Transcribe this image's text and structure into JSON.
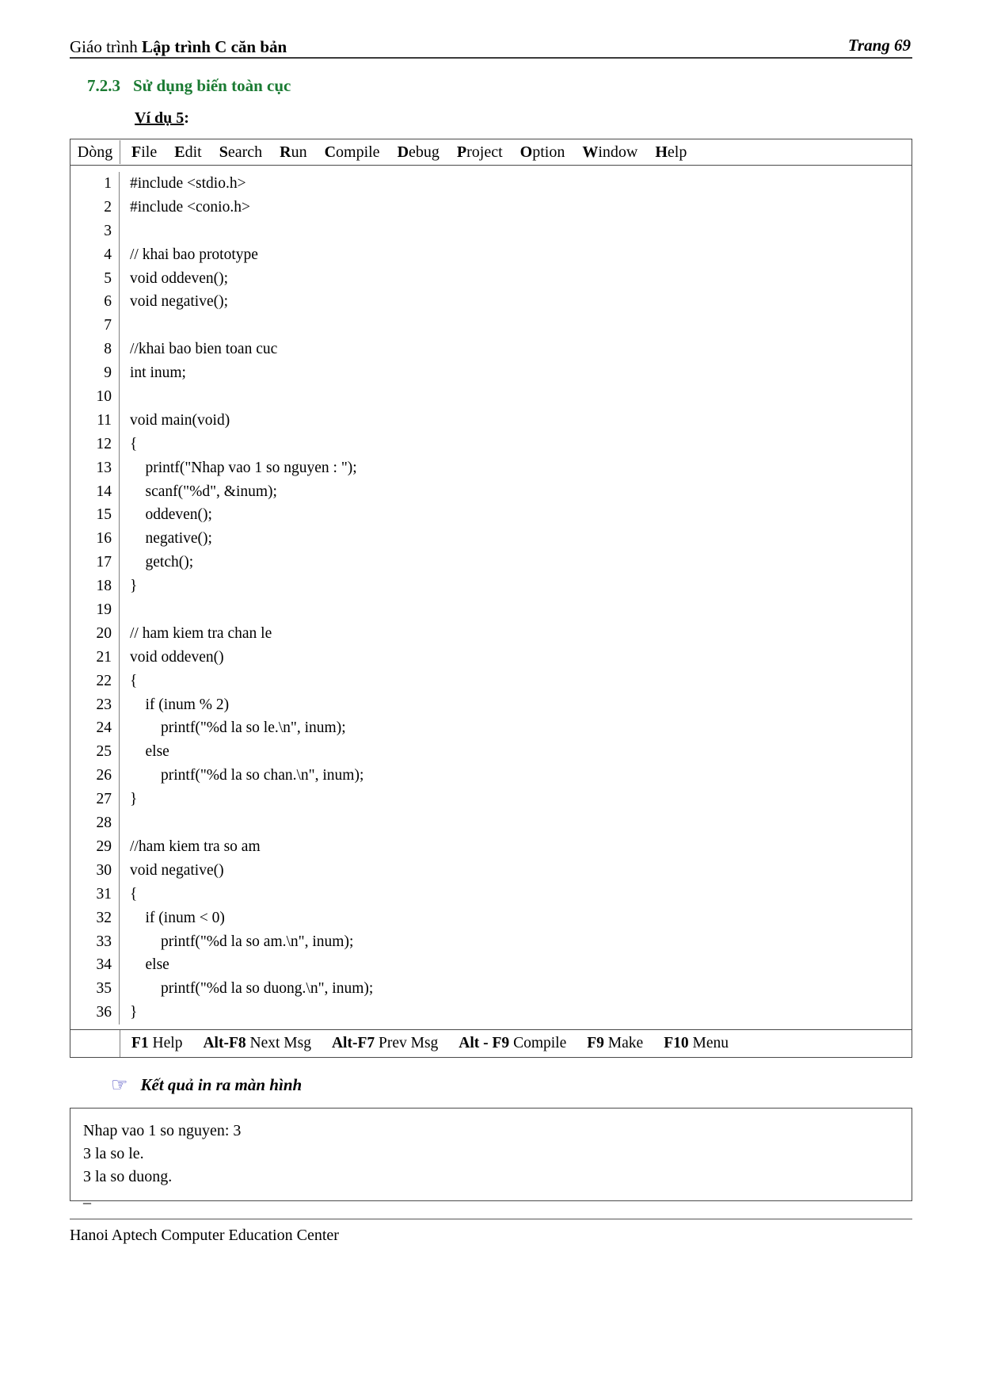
{
  "header": {
    "left_plain": "Giáo trình ",
    "left_strong": "Lập trình C căn bản",
    "right": "Trang 69"
  },
  "section": {
    "number": "7.2.3",
    "title": "Sử dụng biến toàn cục",
    "color": "#1a7a32"
  },
  "example": {
    "label_underlined": "Ví dụ 5",
    "label_tail": ":"
  },
  "code_window": {
    "gutter_header": "Dòng",
    "menu_items": [
      {
        "hot": "F",
        "rest": "ile"
      },
      {
        "hot": "E",
        "rest": "dit"
      },
      {
        "hot": "S",
        "rest": "earch"
      },
      {
        "hot": "R",
        "rest": "un"
      },
      {
        "hot": "C",
        "rest": "ompile"
      },
      {
        "hot": "D",
        "rest": "ebug"
      },
      {
        "hot": "P",
        "rest": "roject"
      },
      {
        "hot": "O",
        "rest": "ption"
      },
      {
        "hot": "W",
        "rest": "indow"
      },
      {
        "hot": "H",
        "rest": "elp"
      }
    ],
    "line_numbers": [
      "1",
      "2",
      "3",
      "4",
      "5",
      "6",
      "7",
      "8",
      "9",
      "10",
      "11",
      "12",
      "13",
      "14",
      "15",
      "16",
      "17",
      "18",
      "19",
      "20",
      "21",
      "22",
      "23",
      "24",
      "25",
      "26",
      "27",
      "28",
      "29",
      "30",
      "31",
      "32",
      "33",
      "34",
      "35",
      "36"
    ],
    "lines": [
      "#include <stdio.h>",
      "#include <conio.h>",
      "",
      "// khai bao prototype",
      "void oddeven();",
      "void negative();",
      "",
      "//khai bao bien toan cuc",
      "int inum;",
      "",
      "void main(void)",
      "{",
      "    printf(\"Nhap vao 1 so nguyen : \");",
      "    scanf(\"%d\", &inum);",
      "    oddeven();",
      "    negative();",
      "    getch();",
      "}",
      "",
      "// ham kiem tra chan le",
      "void oddeven()",
      "{",
      "    if (inum % 2)",
      "        printf(\"%d la so le.\\n\", inum);",
      "    else",
      "        printf(\"%d la so chan.\\n\", inum);",
      "}",
      "",
      "//ham kiem tra so am",
      "void negative()",
      "{",
      "    if (inum < 0)",
      "        printf(\"%d la so am.\\n\", inum);",
      "    else",
      "        printf(\"%d la so duong.\\n\", inum);",
      "}"
    ],
    "status_items": [
      {
        "key": "F1",
        "label": "Help"
      },
      {
        "key": "Alt-F8",
        "label": "Next Msg"
      },
      {
        "key": "Alt-F7",
        "label": "Prev Msg"
      },
      {
        "key": "Alt - F9",
        "label": "Compile"
      },
      {
        "key": "F9",
        "label": "Make"
      },
      {
        "key": "F10",
        "label": "Menu"
      }
    ]
  },
  "result": {
    "icon": "pointing-hand-icon",
    "icon_glyph": "☞",
    "icon_color": "#3b3bbb",
    "caption": "Kết quả in ra màn hình",
    "output_lines": [
      "Nhap vao 1 so nguyen: 3",
      "3 la so le.",
      "3 la so duong."
    ],
    "cursor": "_"
  },
  "footer": {
    "text": "Hanoi Aptech Computer Education Center"
  }
}
